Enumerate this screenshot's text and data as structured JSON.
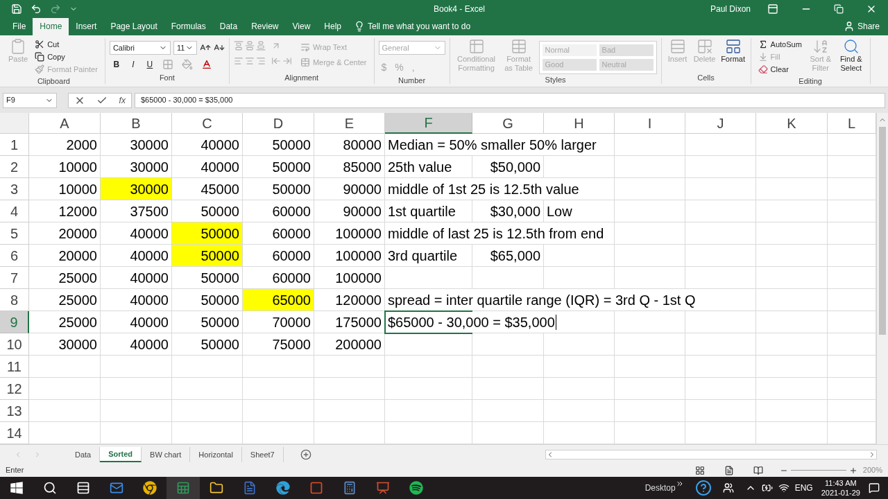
{
  "window": {
    "title": "Book4 - Excel",
    "user": "Paul Dixon"
  },
  "ribbon_tabs": [
    {
      "label": "File",
      "selected": false
    },
    {
      "label": "Home",
      "selected": true
    },
    {
      "label": "Insert",
      "selected": false
    },
    {
      "label": "Page Layout",
      "selected": false
    },
    {
      "label": "Formulas",
      "selected": false
    },
    {
      "label": "Data",
      "selected": false
    },
    {
      "label": "Review",
      "selected": false
    },
    {
      "label": "View",
      "selected": false
    },
    {
      "label": "Help",
      "selected": false
    }
  ],
  "tell_me": "Tell me what you want to do",
  "share": "Share",
  "ribbon_groups": [
    {
      "kind": "clipboard",
      "name": "Clipboard",
      "items": [
        {
          "label": "Paste",
          "disabled": true
        },
        {
          "label": "Cut",
          "disabled": false
        },
        {
          "label": "Copy",
          "disabled": false
        },
        {
          "label": "Format Painter",
          "disabled": true
        }
      ]
    },
    {
      "kind": "font",
      "name": "Font",
      "items": [
        {
          "label": "Calibri",
          "disabled": false
        },
        {
          "label": "11",
          "disabled": false
        },
        {
          "label": "B",
          "disabled": false
        },
        {
          "label": "I",
          "disabled": false
        },
        {
          "label": "U",
          "disabled": false
        }
      ]
    },
    {
      "kind": "alignment",
      "name": "Alignment",
      "items": [
        {
          "label": "Wrap Text",
          "disabled": true
        },
        {
          "label": "Merge & Center",
          "disabled": true
        }
      ]
    },
    {
      "kind": "number",
      "name": "Number",
      "items": [
        {
          "label": "General",
          "disabled": true
        },
        {
          "label": "$",
          "disabled": true
        },
        {
          "label": "%",
          "disabled": true
        },
        {
          "label": ",",
          "disabled": true
        }
      ]
    },
    {
      "kind": "styles",
      "name": "Styles",
      "items": [
        {
          "label": "Conditional Formatting",
          "disabled": true
        },
        {
          "label": "Format as Table",
          "disabled": true
        }
      ],
      "styles": [
        {
          "label": "Normal",
          "disabled": true
        },
        {
          "label": "Bad",
          "disabled": true
        },
        {
          "label": "Good",
          "disabled": true
        },
        {
          "label": "Neutral",
          "disabled": true
        }
      ]
    },
    {
      "kind": "cells",
      "name": "Cells",
      "items": [
        {
          "label": "Insert",
          "disabled": true
        },
        {
          "label": "Delete",
          "disabled": true
        },
        {
          "label": "Format",
          "disabled": false
        }
      ]
    },
    {
      "kind": "editing",
      "name": "Editing",
      "items": [
        {
          "label": "AutoSum",
          "disabled": false
        },
        {
          "label": "Fill",
          "disabled": true
        },
        {
          "label": "Clear",
          "disabled": false
        },
        {
          "label": "Sort & Filter",
          "disabled": true
        },
        {
          "label": "Find & Select",
          "disabled": false
        }
      ]
    }
  ],
  "name_box": "F9",
  "function_label": "fx",
  "formula": "$65000 - 30,000 = $35,000",
  "columns": [
    {
      "label": "A",
      "selected": false
    },
    {
      "label": "B",
      "selected": false
    },
    {
      "label": "C",
      "selected": false
    },
    {
      "label": "D",
      "selected": false
    },
    {
      "label": "E",
      "selected": false
    },
    {
      "label": "F",
      "selected": true
    },
    {
      "label": "G",
      "selected": false
    },
    {
      "label": "H",
      "selected": false
    },
    {
      "label": "I",
      "selected": false
    },
    {
      "label": "J",
      "selected": false
    },
    {
      "label": "K",
      "selected": false
    },
    {
      "label": "L",
      "selected": false
    }
  ],
  "rows": [
    {
      "header": "1",
      "selected": false,
      "values": [
        {
          "text": "2000",
          "highlighted": false
        },
        {
          "text": "30000",
          "highlighted": false
        },
        {
          "text": "40000",
          "highlighted": false
        },
        {
          "text": "50000",
          "highlighted": false
        },
        {
          "text": "80000",
          "highlighted": false
        }
      ],
      "notes": [
        {
          "text": "Median = 50% smaller 50% larger",
          "kind": "label"
        }
      ]
    },
    {
      "header": "2",
      "selected": false,
      "values": [
        {
          "text": "10000",
          "highlighted": false
        },
        {
          "text": "30000",
          "highlighted": false
        },
        {
          "text": "40000",
          "highlighted": false
        },
        {
          "text": "50000",
          "highlighted": false
        },
        {
          "text": "85000",
          "highlighted": false
        }
      ],
      "notes": [
        {
          "text": "25th value",
          "kind": "label"
        },
        {
          "text": "$50,000",
          "kind": "amount"
        }
      ]
    },
    {
      "header": "3",
      "selected": false,
      "values": [
        {
          "text": "10000",
          "highlighted": false
        },
        {
          "text": "30000",
          "highlighted": true
        },
        {
          "text": "45000",
          "highlighted": false
        },
        {
          "text": "50000",
          "highlighted": false
        },
        {
          "text": "90000",
          "highlighted": false
        }
      ],
      "notes": [
        {
          "text": "middle of 1st 25 is 12.5th value",
          "kind": "label"
        }
      ]
    },
    {
      "header": "4",
      "selected": false,
      "values": [
        {
          "text": "12000",
          "highlighted": false
        },
        {
          "text": "37500",
          "highlighted": false
        },
        {
          "text": "50000",
          "highlighted": false
        },
        {
          "text": "60000",
          "highlighted": false
        },
        {
          "text": "90000",
          "highlighted": false
        }
      ],
      "notes": [
        {
          "text": "1st quartile",
          "kind": "label"
        },
        {
          "text": "$30,000",
          "kind": "amount"
        },
        {
          "text": "Low",
          "kind": "label"
        }
      ]
    },
    {
      "header": "5",
      "selected": false,
      "values": [
        {
          "text": "20000",
          "highlighted": false
        },
        {
          "text": "40000",
          "highlighted": false
        },
        {
          "text": "50000",
          "highlighted": true
        },
        {
          "text": "60000",
          "highlighted": false
        },
        {
          "text": "100000",
          "highlighted": false
        }
      ],
      "notes": [
        {
          "text": "middle of last 25 is 12.5th from end",
          "kind": "label"
        }
      ]
    },
    {
      "header": "6",
      "selected": false,
      "values": [
        {
          "text": "20000",
          "highlighted": false
        },
        {
          "text": "40000",
          "highlighted": false
        },
        {
          "text": "50000",
          "highlighted": true
        },
        {
          "text": "60000",
          "highlighted": false
        },
        {
          "text": "100000",
          "highlighted": false
        }
      ],
      "notes": [
        {
          "text": "3rd quartile",
          "kind": "label"
        },
        {
          "text": "$65,000",
          "kind": "amount"
        }
      ]
    },
    {
      "header": "7",
      "selected": false,
      "values": [
        {
          "text": "25000",
          "highlighted": false
        },
        {
          "text": "40000",
          "highlighted": false
        },
        {
          "text": "50000",
          "highlighted": false
        },
        {
          "text": "60000",
          "highlighted": false
        },
        {
          "text": "100000",
          "highlighted": false
        }
      ]
    },
    {
      "header": "8",
      "selected": false,
      "values": [
        {
          "text": "25000",
          "highlighted": false
        },
        {
          "text": "40000",
          "highlighted": false
        },
        {
          "text": "50000",
          "highlighted": false
        },
        {
          "text": "65000",
          "highlighted": true
        },
        {
          "text": "120000",
          "highlighted": false
        }
      ],
      "notes": [
        {
          "text": "spread = inter quartile range (IQR) = 3rd Q - 1st Q",
          "kind": "label"
        }
      ]
    },
    {
      "header": "9",
      "selected": true,
      "values": [
        {
          "text": "25000",
          "highlighted": false
        },
        {
          "text": "40000",
          "highlighted": false
        },
        {
          "text": "50000",
          "highlighted": false
        },
        {
          "text": "70000",
          "highlighted": false
        },
        {
          "text": "175000",
          "highlighted": false
        }
      ],
      "notes": [
        {
          "text": "$65000 - 30,000 = $35,000",
          "kind": "label"
        }
      ]
    },
    {
      "header": "10",
      "selected": false,
      "values": [
        {
          "text": "30000",
          "highlighted": false
        },
        {
          "text": "40000",
          "highlighted": false
        },
        {
          "text": "50000",
          "highlighted": false
        },
        {
          "text": "75000",
          "highlighted": false
        },
        {
          "text": "200000",
          "highlighted": false
        }
      ]
    },
    {
      "header": "11",
      "selected": false
    },
    {
      "header": "12",
      "selected": false
    },
    {
      "header": "13",
      "selected": false
    },
    {
      "header": "14",
      "selected": false
    }
  ],
  "sheet_tabs": [
    {
      "label": "Data",
      "selected": false
    },
    {
      "label": "Sorted",
      "selected": true
    },
    {
      "label": "BW chart",
      "selected": false
    },
    {
      "label": "Horizontal",
      "selected": false
    },
    {
      "label": "Sheet7",
      "selected": false
    }
  ],
  "status": {
    "mode": "Enter",
    "zoom": "200%"
  },
  "taskbar": {
    "desktop": "Desktop",
    "language": "ENG",
    "time": "11:43 AM",
    "date": "2021-01-29"
  }
}
